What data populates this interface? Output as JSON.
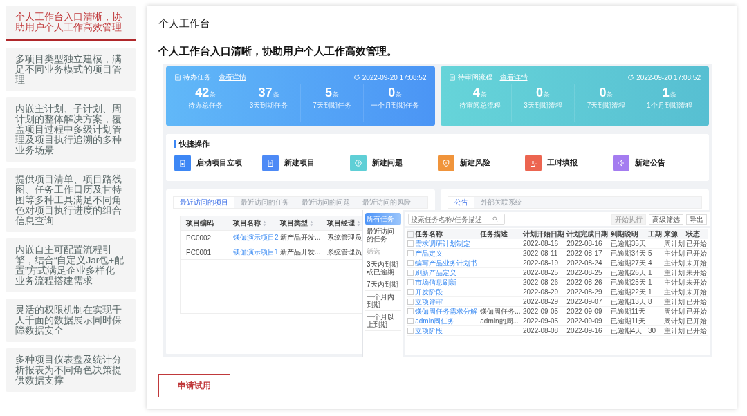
{
  "sidebar": {
    "items": [
      {
        "text": "个人工作台入口清晰，协助用户个人工作高效管理",
        "selected": true
      },
      {
        "text": "多项目类型独立建模，满足不同业务模式的项目管理",
        "selected": false
      },
      {
        "text": "内嵌主计划、子计划、周计划的整体解决方案，覆盖项目过程中多级计划管理及项目执行追溯的多种业务场景",
        "selected": false
      },
      {
        "text": "提供项目清单、项目路线图、任务工作日历及甘特图等多种工具满足不同角色对项目执行进度的组合信息查询",
        "selected": false
      },
      {
        "text": "内嵌自主可配置流程引擎，结合“自定义Jar包+配置”方式满足企业多样化业务流程搭建需求",
        "selected": false
      },
      {
        "text": "灵活的权限机制在实现千人千面的数据展示同时保障数据安全",
        "selected": false
      },
      {
        "text": "多种项目仪表盘及统计分析报表为不同角色决策提供数据支撑",
        "selected": false
      }
    ]
  },
  "main": {
    "title": "个人工作台",
    "headline": "个人工作台入口清晰，协助用户个人工作高效管理。"
  },
  "dashboard": {
    "summary_cards": [
      {
        "kind": "tasks",
        "title": "待办任务",
        "link": "查看详情",
        "time": "2022-09-20 17:08:52",
        "stats": [
          {
            "value": "42",
            "unit": "条",
            "label": "待办总任务"
          },
          {
            "value": "37",
            "unit": "条",
            "label": "3天到期任务"
          },
          {
            "value": "5",
            "unit": "条",
            "label": "7天到期任务"
          },
          {
            "value": "0",
            "unit": "条",
            "label": "一个月到期任务"
          }
        ]
      },
      {
        "kind": "flows",
        "title": "待审阅流程",
        "link": "查看详情",
        "time": "2022-09-20 17:08:52",
        "stats": [
          {
            "value": "4",
            "unit": "条",
            "label": "待审阅总流程"
          },
          {
            "value": "0",
            "unit": "条",
            "label": "3天到期流程"
          },
          {
            "value": "0",
            "unit": "条",
            "label": "7天到期流程"
          },
          {
            "value": "1",
            "unit": "条",
            "label": "1个月到期流程"
          }
        ]
      }
    ],
    "quick_actions": {
      "title": "快捷操作",
      "items": [
        {
          "label": "启动项目立项",
          "kind": "clipboard",
          "color": "#3d87f5"
        },
        {
          "label": "新建项目",
          "kind": "file",
          "color": "#4d8af6"
        },
        {
          "label": "新建问题",
          "kind": "question",
          "color": "#5fcfd6"
        },
        {
          "label": "新建风险",
          "kind": "shield",
          "color": "#f0943b"
        },
        {
          "label": "工时填报",
          "kind": "form",
          "color": "#ec6550"
        },
        {
          "label": "新建公告",
          "kind": "speaker",
          "color": "#a47cf0"
        }
      ]
    },
    "recent_panel": {
      "tabs": [
        {
          "label": "最近访问的项目",
          "selected": true
        },
        {
          "label": "最近访问的任务",
          "selected": false
        },
        {
          "label": "最近访问的问题",
          "selected": false
        },
        {
          "label": "最近访问的风险",
          "selected": false
        }
      ],
      "columns": [
        {
          "label": "项目编码",
          "sortable": false
        },
        {
          "label": "项目名称",
          "sortable": true
        },
        {
          "label": "项目类型",
          "sortable": true
        },
        {
          "label": "项目经理",
          "sortable": true
        }
      ],
      "rows": [
        [
          "PC0002",
          "镁伽演示项目2",
          "新产品开发...",
          "系统管理员"
        ],
        [
          "PC0001",
          "镁伽演示项目1",
          "新产品开发...",
          "系统管理员"
        ]
      ]
    },
    "notice_panel": {
      "tabs": [
        {
          "label": "公告",
          "selected": true
        },
        {
          "label": "外部关联系统",
          "selected": false
        }
      ]
    },
    "task_overlay": {
      "nav": [
        {
          "kind": "item",
          "label": "所有任务",
          "selected": true
        },
        {
          "kind": "item",
          "label": "最近访问的任务",
          "selected": false
        },
        {
          "kind": "heading",
          "label": "筛选",
          "selected": false
        },
        {
          "kind": "item",
          "label": "3天内到期或已逾期",
          "selected": false
        },
        {
          "kind": "item",
          "label": "7天内到期",
          "selected": false
        },
        {
          "kind": "item",
          "label": "一个月内到期",
          "selected": false
        },
        {
          "kind": "item",
          "label": "一个月以上到期",
          "selected": false
        }
      ],
      "search": {
        "placeholder": "搜索任务名称/任务描述"
      },
      "buttons": [
        {
          "label": "开始执行",
          "disabled": true
        },
        {
          "label": "高级筛选",
          "disabled": false
        },
        {
          "label": "导出",
          "disabled": false
        }
      ],
      "header_checked": false,
      "columns": [
        "任务名称",
        "任务描述",
        "计划开始日期",
        "计划完成日期",
        "到期说明",
        "工期",
        "来源",
        "状态"
      ],
      "rows": [
        {
          "checked": false,
          "name": "需求调研计划制定",
          "start": "2022-08-16",
          "end": "2022-08-16",
          "due": "已逾期35天",
          "source": "周计划",
          "status": "已开始"
        },
        {
          "checked": false,
          "name": "产品定义",
          "start": "2022-08-11",
          "end": "2022-08-17",
          "due": "已逾期34天",
          "duration": "5",
          "source": "主计划",
          "status": "已开始"
        },
        {
          "checked": false,
          "name": "编写产品业务计划书",
          "start": "2022-08-19",
          "end": "2022-08-24",
          "due": "已逾期27天",
          "duration": "4",
          "source": "主计划",
          "status": "未开始"
        },
        {
          "checked": false,
          "name": "刷新产品定义",
          "start": "2022-08-25",
          "end": "2022-08-25",
          "due": "已逾期26天",
          "duration": "1",
          "source": "主计划",
          "status": "未开始"
        },
        {
          "checked": false,
          "name": "市场信息刷新",
          "start": "2022-08-26",
          "end": "2022-08-26",
          "due": "已逾期25天",
          "duration": "1",
          "source": "主计划",
          "status": "未开始"
        },
        {
          "checked": false,
          "name": "开发阶段",
          "start": "2022-08-29",
          "end": "2022-08-29",
          "due": "已逾期22天",
          "duration": "1",
          "source": "主计划",
          "status": "未开始"
        },
        {
          "checked": false,
          "name": "立项评审",
          "start": "2022-08-29",
          "end": "2022-09-07",
          "due": "已逾期13天",
          "duration": "8",
          "source": "主计划",
          "status": "已开始"
        },
        {
          "checked": false,
          "name": "镁伽周任务需求分解",
          "desc": "镁伽周任务...",
          "start": "2022-09-05",
          "end": "2022-09-09",
          "due": "已逾期11天",
          "source": "周计划",
          "status": "已开始"
        },
        {
          "checked": false,
          "name": "admin周任务",
          "desc": "admin的周...",
          "start": "2022-09-05",
          "end": "2022-09-09",
          "due": "已逾期11天",
          "source": "周计划",
          "status": "已开始"
        },
        {
          "checked": false,
          "name": "立项阶段",
          "start": "2022-08-08",
          "end": "2022-09-16",
          "due": "已逾期4天",
          "duration": "30",
          "source": "主计划",
          "status": "已开始"
        }
      ]
    }
  },
  "apply_button": "申请试用"
}
